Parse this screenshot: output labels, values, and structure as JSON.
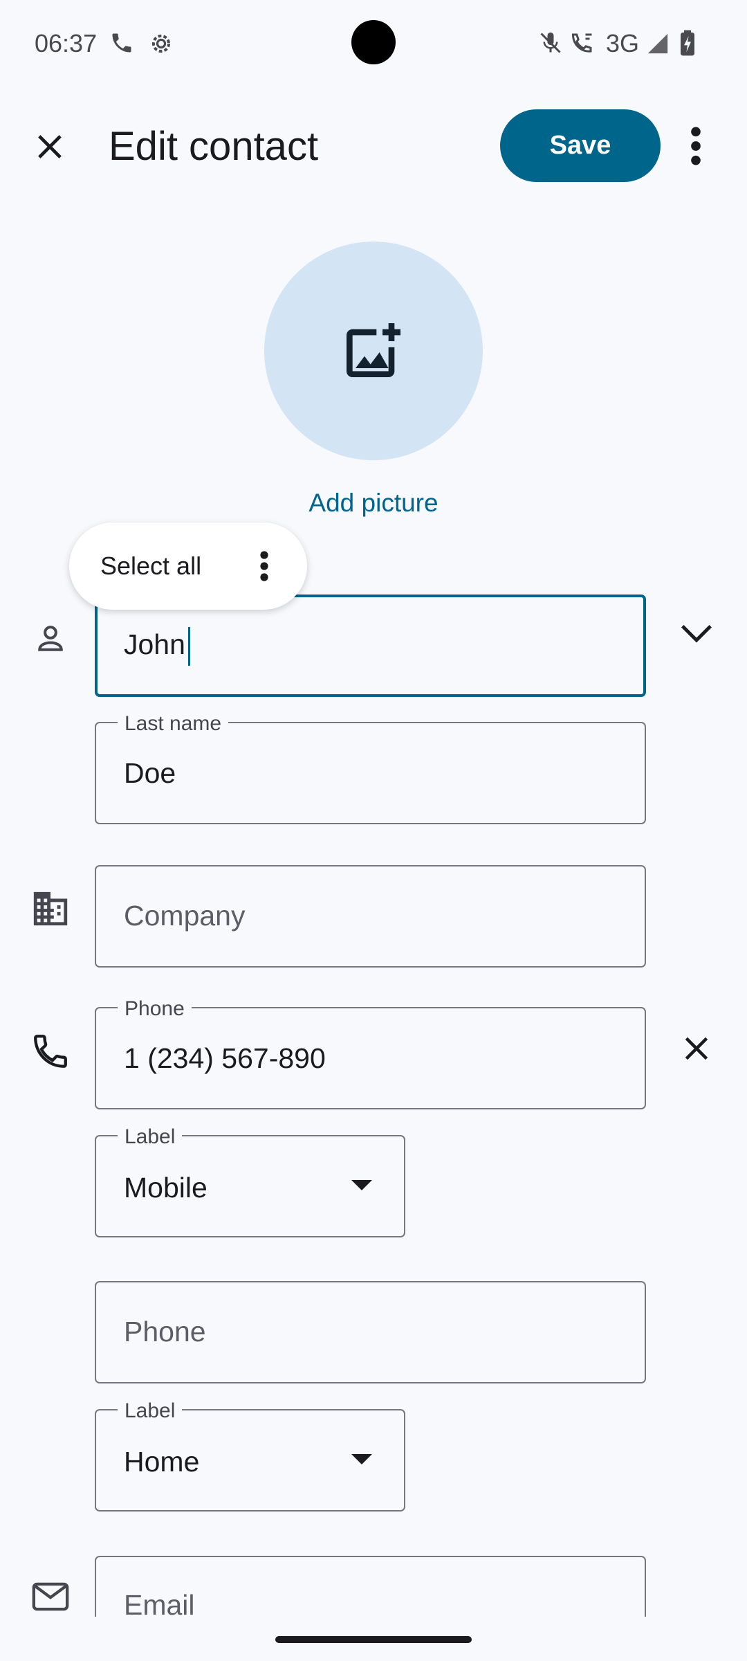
{
  "status_bar": {
    "time": "06:37",
    "network": "3G",
    "icons": [
      "phone-icon",
      "settings-gear-icon",
      "mute-icon",
      "wifi-calling-icon",
      "signal-icon",
      "battery-charging-icon"
    ]
  },
  "app_bar": {
    "title": "Edit contact",
    "save_label": "Save",
    "icons": [
      "close-icon",
      "more-vert-icon"
    ]
  },
  "avatar": {
    "add_picture_label": "Add picture",
    "icon": "add-photo-icon",
    "color": "#d3e4f4"
  },
  "selection_popup": {
    "select_all_label": "Select all",
    "icon": "more-vert-icon"
  },
  "name": {
    "first_name_value": "John",
    "last_name_label": "Last name",
    "last_name_value": "Doe"
  },
  "company": {
    "placeholder": "Company"
  },
  "phone_1": {
    "label": "Phone",
    "value": "1 (234) 567-890",
    "type_label": "Label",
    "type_value": "Mobile"
  },
  "phone_2": {
    "placeholder": "Phone",
    "type_label": "Label",
    "type_value": "Home"
  },
  "email": {
    "placeholder": "Email"
  },
  "colors": {
    "accent": "#00658b",
    "background": "#f8f9fd",
    "outline": "#74777f"
  }
}
